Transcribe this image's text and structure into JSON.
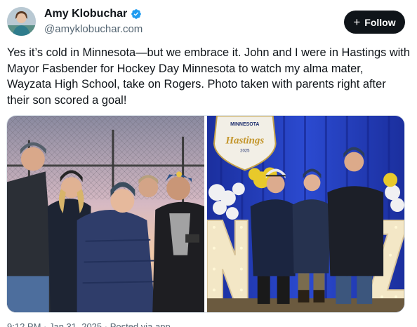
{
  "author": {
    "display_name": "Amy Klobuchar",
    "handle": "@amyklobuchar.com",
    "avatar_icon": "profile-photo",
    "verified": true,
    "verified_color": "#1d9bf0"
  },
  "follow_button": {
    "label": "Follow",
    "icon": "plus-icon",
    "background": "#0f1419"
  },
  "post": {
    "text": "Yes it’s cold in Minnesota—but we embrace it. John and I were in Hastings with Mayor Fasbender for Hockey Day Minnesota to watch my alma mater, Wayzata High School, take on Rogers. Photo taken with parents right after their son scored a goal!"
  },
  "media": {
    "count": 2,
    "photo_2_text": {
      "sign_top": "MINNESOTA",
      "sign_main": "Hastings",
      "sign_year": "2025"
    }
  },
  "footer": {
    "meta": "9:12 PM · Jan 31, 2025 · Posted via app"
  }
}
